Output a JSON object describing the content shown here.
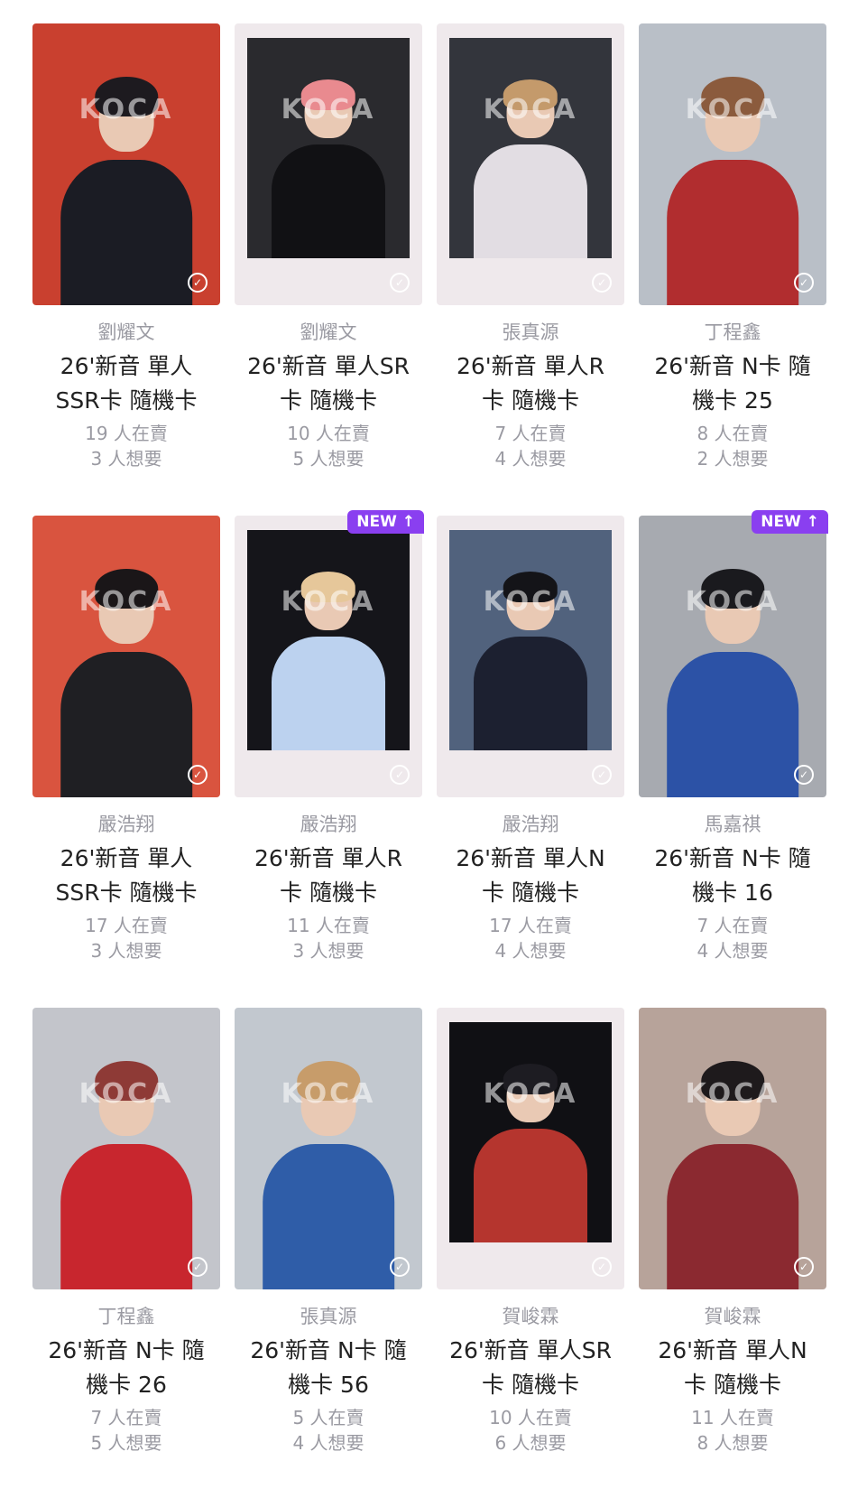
{
  "watermark": "KOCA",
  "badge_label": "NEW ↑",
  "check_icon": "✓",
  "cards": [
    {
      "name": "劉耀文",
      "title_l1": "26'新音 單人",
      "title_l2": "SSR卡 隨機卡",
      "selling": "19 人在賣",
      "wanting": "3 人想要",
      "style": "full",
      "bg": "#c9402f",
      "hair": "#1d1a1f",
      "cloth": "#1b1c24",
      "new": false
    },
    {
      "name": "劉耀文",
      "title_l1": "26'新音 單人SR",
      "title_l2": "卡 隨機卡",
      "selling": "10 人在賣",
      "wanting": "5 人想要",
      "style": "frame",
      "bg": "#2a2a2e",
      "hair": "#e98a8f",
      "cloth": "#111114",
      "new": false
    },
    {
      "name": "張真源",
      "title_l1": "26'新音 單人R",
      "title_l2": "卡 隨機卡",
      "selling": "7 人在賣",
      "wanting": "4 人想要",
      "style": "frame",
      "bg": "#33353c",
      "hair": "#c49a6b",
      "cloth": "#e2dde3",
      "new": false
    },
    {
      "name": "丁程鑫",
      "title_l1": "26'新音 N卡 隨",
      "title_l2": "機卡 25",
      "selling": "8 人在賣",
      "wanting": "2 人想要",
      "style": "full",
      "bg": "#b9bfc7",
      "hair": "#8b5b3d",
      "cloth": "#b12d2f",
      "new": false
    },
    {
      "name": "嚴浩翔",
      "title_l1": "26'新音 單人",
      "title_l2": "SSR卡 隨機卡",
      "selling": "17 人在賣",
      "wanting": "3 人想要",
      "style": "full",
      "bg": "#d9543f",
      "hair": "#1a1618",
      "cloth": "#1f1f23",
      "new": false
    },
    {
      "name": "嚴浩翔",
      "title_l1": "26'新音 單人R",
      "title_l2": "卡 隨機卡",
      "selling": "11 人在賣",
      "wanting": "3 人想要",
      "style": "frame",
      "bg": "#15151a",
      "hair": "#e6c79a",
      "cloth": "#bcd2ef",
      "new": true
    },
    {
      "name": "嚴浩翔",
      "title_l1": "26'新音 單人N",
      "title_l2": "卡 隨機卡",
      "selling": "17 人在賣",
      "wanting": "4 人想要",
      "style": "frame",
      "bg": "#51627d",
      "hair": "#141418",
      "cloth": "#1c2030",
      "new": false
    },
    {
      "name": "馬嘉祺",
      "title_l1": "26'新音 N卡 隨",
      "title_l2": "機卡 16",
      "selling": "7 人在賣",
      "wanting": "4 人想要",
      "style": "full",
      "bg": "#a7aab0",
      "hair": "#1a1a1e",
      "cloth": "#2c52a6",
      "new": true
    },
    {
      "name": "丁程鑫",
      "title_l1": "26'新音 N卡 隨",
      "title_l2": "機卡 26",
      "selling": "7 人在賣",
      "wanting": "5 人想要",
      "style": "full",
      "bg": "#c3c5cb",
      "hair": "#8e3a36",
      "cloth": "#c8262e",
      "new": false
    },
    {
      "name": "張真源",
      "title_l1": "26'新音 N卡 隨",
      "title_l2": "機卡 56",
      "selling": "5 人在賣",
      "wanting": "4 人想要",
      "style": "full",
      "bg": "#c2c8cf",
      "hair": "#c79c6a",
      "cloth": "#2f5da8",
      "new": false
    },
    {
      "name": "賀峻霖",
      "title_l1": "26'新音 單人SR",
      "title_l2": "卡 隨機卡",
      "selling": "10 人在賣",
      "wanting": "6 人想要",
      "style": "frame",
      "bg": "#101014",
      "hair": "#1d1c22",
      "cloth": "#b5352e",
      "new": false
    },
    {
      "name": "賀峻霖",
      "title_l1": "26'新音 單人N",
      "title_l2": "卡 隨機卡",
      "selling": "11 人在賣",
      "wanting": "8 人想要",
      "style": "full",
      "bg": "#b7a39a",
      "hair": "#1e1a1c",
      "cloth": "#8b2930",
      "new": false
    }
  ]
}
